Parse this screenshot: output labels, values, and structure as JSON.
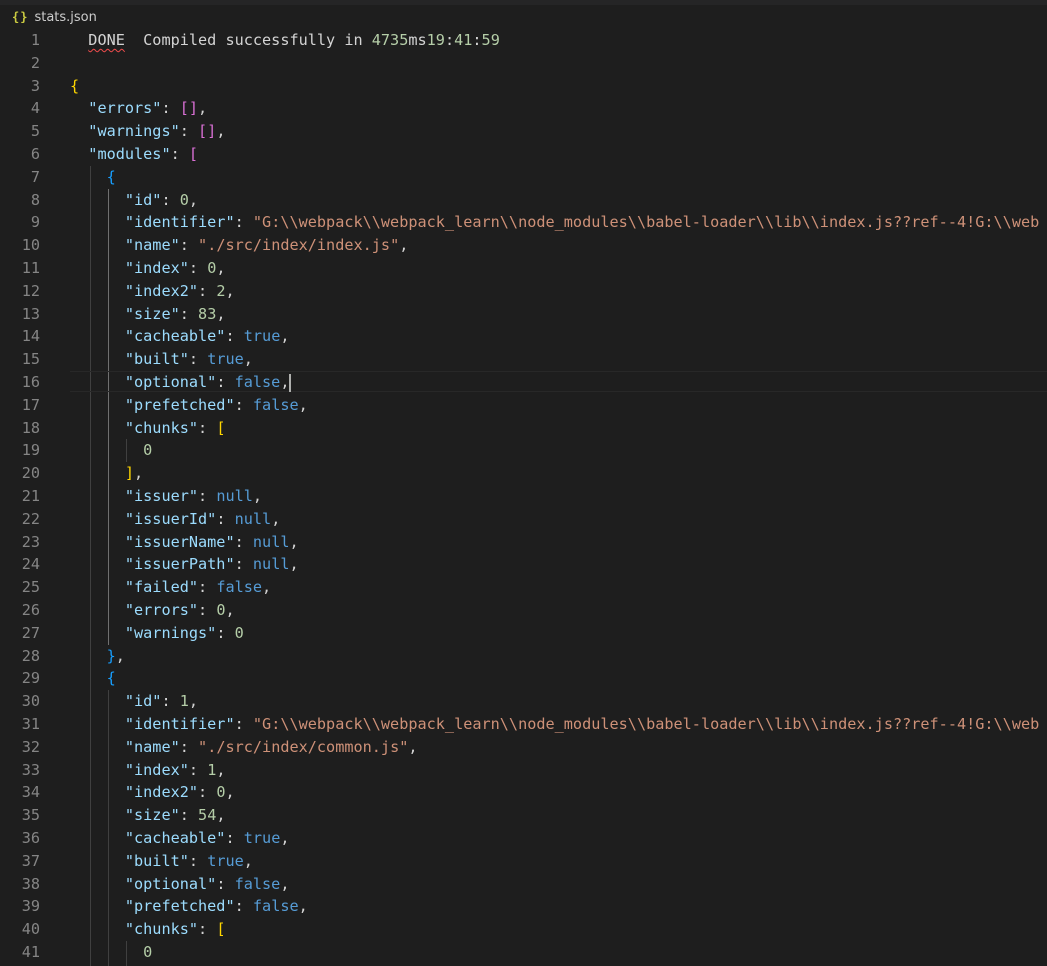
{
  "tab": {
    "icon": "{}",
    "filename": "stats.json"
  },
  "colors": {
    "background": "#1e1e1e",
    "key": "#9cdcfe",
    "string": "#ce9178",
    "number": "#b5cea8",
    "boolean_null": "#569cd6",
    "bracket_level1": "#ffd700",
    "bracket_level2": "#da70d6",
    "bracket_level3": "#179fff",
    "line_number": "#858585",
    "error_squiggle": "#f14c4c"
  },
  "lines": [
    {
      "num": "1",
      "tokens": [
        [
          "p",
          "  "
        ],
        [
          "sq",
          "DONE"
        ],
        [
          "p",
          "  Compiled successfully in "
        ],
        [
          "n",
          "4735"
        ],
        [
          "p",
          "ms"
        ],
        [
          "n",
          "19"
        ],
        [
          "p",
          ":"
        ],
        [
          "n",
          "41"
        ],
        [
          "p",
          ":"
        ],
        [
          "n",
          "59"
        ]
      ]
    },
    {
      "num": "2",
      "tokens": []
    },
    {
      "num": "3",
      "tokens": [
        [
          "br1",
          "{"
        ]
      ]
    },
    {
      "num": "4",
      "tokens": [
        [
          "p",
          "  "
        ],
        [
          "k",
          "\"errors\""
        ],
        [
          "p",
          ": "
        ],
        [
          "br2",
          "[]"
        ],
        [
          "p",
          ","
        ]
      ]
    },
    {
      "num": "5",
      "tokens": [
        [
          "p",
          "  "
        ],
        [
          "k",
          "\"warnings\""
        ],
        [
          "p",
          ": "
        ],
        [
          "br2",
          "[]"
        ],
        [
          "p",
          ","
        ]
      ]
    },
    {
      "num": "6",
      "tokens": [
        [
          "p",
          "  "
        ],
        [
          "k",
          "\"modules\""
        ],
        [
          "p",
          ": "
        ],
        [
          "br2",
          "["
        ]
      ]
    },
    {
      "num": "7",
      "tokens": [
        [
          "p",
          "    "
        ],
        [
          "br3",
          "{"
        ]
      ]
    },
    {
      "num": "8",
      "tokens": [
        [
          "p",
          "      "
        ],
        [
          "k",
          "\"id\""
        ],
        [
          "p",
          ": "
        ],
        [
          "n",
          "0"
        ],
        [
          "p",
          ","
        ]
      ]
    },
    {
      "num": "9",
      "tokens": [
        [
          "p",
          "      "
        ],
        [
          "k",
          "\"identifier\""
        ],
        [
          "p",
          ": "
        ],
        [
          "s",
          "\"G:\\\\webpack\\\\webpack_learn\\\\node_modules\\\\babel-loader\\\\lib\\\\index.js??ref--4!G:\\\\web"
        ]
      ]
    },
    {
      "num": "10",
      "tokens": [
        [
          "p",
          "      "
        ],
        [
          "k",
          "\"name\""
        ],
        [
          "p",
          ": "
        ],
        [
          "s",
          "\"./src/index/index.js\""
        ],
        [
          "p",
          ","
        ]
      ]
    },
    {
      "num": "11",
      "tokens": [
        [
          "p",
          "      "
        ],
        [
          "k",
          "\"index\""
        ],
        [
          "p",
          ": "
        ],
        [
          "n",
          "0"
        ],
        [
          "p",
          ","
        ]
      ]
    },
    {
      "num": "12",
      "tokens": [
        [
          "p",
          "      "
        ],
        [
          "k",
          "\"index2\""
        ],
        [
          "p",
          ": "
        ],
        [
          "n",
          "2"
        ],
        [
          "p",
          ","
        ]
      ]
    },
    {
      "num": "13",
      "tokens": [
        [
          "p",
          "      "
        ],
        [
          "k",
          "\"size\""
        ],
        [
          "p",
          ": "
        ],
        [
          "n",
          "83"
        ],
        [
          "p",
          ","
        ]
      ]
    },
    {
      "num": "14",
      "tokens": [
        [
          "p",
          "      "
        ],
        [
          "k",
          "\"cacheable\""
        ],
        [
          "p",
          ": "
        ],
        [
          "b",
          "true"
        ],
        [
          "p",
          ","
        ]
      ]
    },
    {
      "num": "15",
      "tokens": [
        [
          "p",
          "      "
        ],
        [
          "k",
          "\"built\""
        ],
        [
          "p",
          ": "
        ],
        [
          "b",
          "true"
        ],
        [
          "p",
          ","
        ]
      ]
    },
    {
      "num": "16",
      "tokens": [
        [
          "p",
          "      "
        ],
        [
          "k",
          "\"optional\""
        ],
        [
          "p",
          ": "
        ],
        [
          "b",
          "false"
        ],
        [
          "p",
          ","
        ]
      ]
    },
    {
      "num": "17",
      "tokens": [
        [
          "p",
          "      "
        ],
        [
          "k",
          "\"prefetched\""
        ],
        [
          "p",
          ": "
        ],
        [
          "b",
          "false"
        ],
        [
          "p",
          ","
        ]
      ]
    },
    {
      "num": "18",
      "tokens": [
        [
          "p",
          "      "
        ],
        [
          "k",
          "\"chunks\""
        ],
        [
          "p",
          ": "
        ],
        [
          "br1",
          "["
        ]
      ]
    },
    {
      "num": "19",
      "tokens": [
        [
          "p",
          "        "
        ],
        [
          "n",
          "0"
        ]
      ]
    },
    {
      "num": "20",
      "tokens": [
        [
          "p",
          "      "
        ],
        [
          "br1",
          "]"
        ],
        [
          "p",
          ","
        ]
      ]
    },
    {
      "num": "21",
      "tokens": [
        [
          "p",
          "      "
        ],
        [
          "k",
          "\"issuer\""
        ],
        [
          "p",
          ": "
        ],
        [
          "b",
          "null"
        ],
        [
          "p",
          ","
        ]
      ]
    },
    {
      "num": "22",
      "tokens": [
        [
          "p",
          "      "
        ],
        [
          "k",
          "\"issuerId\""
        ],
        [
          "p",
          ": "
        ],
        [
          "b",
          "null"
        ],
        [
          "p",
          ","
        ]
      ]
    },
    {
      "num": "23",
      "tokens": [
        [
          "p",
          "      "
        ],
        [
          "k",
          "\"issuerName\""
        ],
        [
          "p",
          ": "
        ],
        [
          "b",
          "null"
        ],
        [
          "p",
          ","
        ]
      ]
    },
    {
      "num": "24",
      "tokens": [
        [
          "p",
          "      "
        ],
        [
          "k",
          "\"issuerPath\""
        ],
        [
          "p",
          ": "
        ],
        [
          "b",
          "null"
        ],
        [
          "p",
          ","
        ]
      ]
    },
    {
      "num": "25",
      "tokens": [
        [
          "p",
          "      "
        ],
        [
          "k",
          "\"failed\""
        ],
        [
          "p",
          ": "
        ],
        [
          "b",
          "false"
        ],
        [
          "p",
          ","
        ]
      ]
    },
    {
      "num": "26",
      "tokens": [
        [
          "p",
          "      "
        ],
        [
          "k",
          "\"errors\""
        ],
        [
          "p",
          ": "
        ],
        [
          "n",
          "0"
        ],
        [
          "p",
          ","
        ]
      ]
    },
    {
      "num": "27",
      "tokens": [
        [
          "p",
          "      "
        ],
        [
          "k",
          "\"warnings\""
        ],
        [
          "p",
          ": "
        ],
        [
          "n",
          "0"
        ]
      ]
    },
    {
      "num": "28",
      "tokens": [
        [
          "p",
          "    "
        ],
        [
          "br3",
          "}"
        ],
        [
          "p",
          ","
        ]
      ]
    },
    {
      "num": "29",
      "tokens": [
        [
          "p",
          "    "
        ],
        [
          "br3",
          "{"
        ]
      ]
    },
    {
      "num": "30",
      "tokens": [
        [
          "p",
          "      "
        ],
        [
          "k",
          "\"id\""
        ],
        [
          "p",
          ": "
        ],
        [
          "n",
          "1"
        ],
        [
          "p",
          ","
        ]
      ]
    },
    {
      "num": "31",
      "tokens": [
        [
          "p",
          "      "
        ],
        [
          "k",
          "\"identifier\""
        ],
        [
          "p",
          ": "
        ],
        [
          "s",
          "\"G:\\\\webpack\\\\webpack_learn\\\\node_modules\\\\babel-loader\\\\lib\\\\index.js??ref--4!G:\\\\web"
        ]
      ]
    },
    {
      "num": "32",
      "tokens": [
        [
          "p",
          "      "
        ],
        [
          "k",
          "\"name\""
        ],
        [
          "p",
          ": "
        ],
        [
          "s",
          "\"./src/index/common.js\""
        ],
        [
          "p",
          ","
        ]
      ]
    },
    {
      "num": "33",
      "tokens": [
        [
          "p",
          "      "
        ],
        [
          "k",
          "\"index\""
        ],
        [
          "p",
          ": "
        ],
        [
          "n",
          "1"
        ],
        [
          "p",
          ","
        ]
      ]
    },
    {
      "num": "34",
      "tokens": [
        [
          "p",
          "      "
        ],
        [
          "k",
          "\"index2\""
        ],
        [
          "p",
          ": "
        ],
        [
          "n",
          "0"
        ],
        [
          "p",
          ","
        ]
      ]
    },
    {
      "num": "35",
      "tokens": [
        [
          "p",
          "      "
        ],
        [
          "k",
          "\"size\""
        ],
        [
          "p",
          ": "
        ],
        [
          "n",
          "54"
        ],
        [
          "p",
          ","
        ]
      ]
    },
    {
      "num": "36",
      "tokens": [
        [
          "p",
          "      "
        ],
        [
          "k",
          "\"cacheable\""
        ],
        [
          "p",
          ": "
        ],
        [
          "b",
          "true"
        ],
        [
          "p",
          ","
        ]
      ]
    },
    {
      "num": "37",
      "tokens": [
        [
          "p",
          "      "
        ],
        [
          "k",
          "\"built\""
        ],
        [
          "p",
          ": "
        ],
        [
          "b",
          "true"
        ],
        [
          "p",
          ","
        ]
      ]
    },
    {
      "num": "38",
      "tokens": [
        [
          "p",
          "      "
        ],
        [
          "k",
          "\"optional\""
        ],
        [
          "p",
          ": "
        ],
        [
          "b",
          "false"
        ],
        [
          "p",
          ","
        ]
      ]
    },
    {
      "num": "39",
      "tokens": [
        [
          "p",
          "      "
        ],
        [
          "k",
          "\"prefetched\""
        ],
        [
          "p",
          ": "
        ],
        [
          "b",
          "false"
        ],
        [
          "p",
          ","
        ]
      ]
    },
    {
      "num": "40",
      "tokens": [
        [
          "p",
          "      "
        ],
        [
          "k",
          "\"chunks\""
        ],
        [
          "p",
          ": "
        ],
        [
          "br1",
          "["
        ]
      ]
    },
    {
      "num": "41",
      "tokens": [
        [
          "p",
          "        "
        ],
        [
          "n",
          "0"
        ]
      ]
    }
  ]
}
